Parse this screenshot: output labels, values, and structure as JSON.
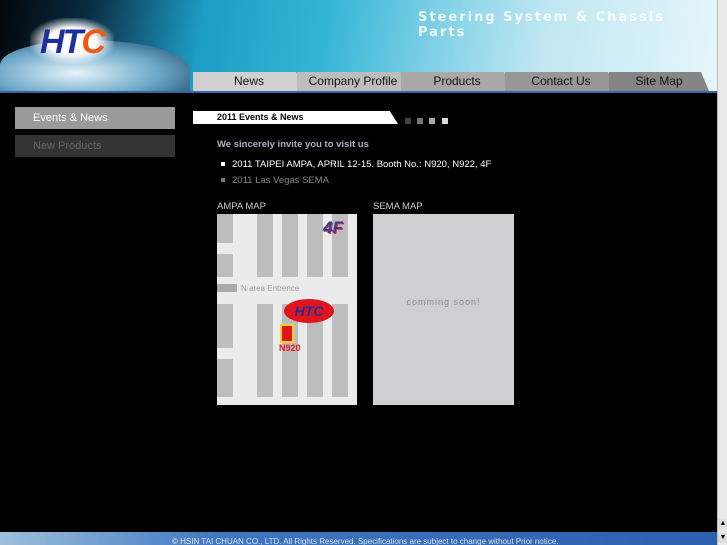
{
  "header": {
    "logo": "HTC",
    "slogan": "Steering System & Chassis Parts"
  },
  "nav": [
    {
      "label": "News"
    },
    {
      "label": "Company Profile"
    },
    {
      "label": "Products"
    },
    {
      "label": "Contact Us"
    },
    {
      "label": "Site Map"
    }
  ],
  "sidebar": {
    "items": [
      {
        "label": "Events & News",
        "active": true
      },
      {
        "label": "New Products",
        "active": false
      }
    ]
  },
  "main": {
    "title": "2011 Events & News",
    "intro": "We sincerely invite you to visit us",
    "events": [
      "2011 TAIPEI AMPA, APRIL 12-15. Booth No.: N920, N922, 4F",
      "2011 Las Vegas SEMA"
    ],
    "ampa_map": {
      "label": "AMPA MAP",
      "floor": "4F",
      "entrance": "N area Entrence",
      "booth": "N920",
      "logo": "HTC"
    },
    "sema_map": {
      "label": "SEMA MAP",
      "status": "comming soon!"
    }
  },
  "footer": {
    "text": "© HSIN TAI CHUAN CO., LTD. All Rights Reserved. Specifications are subject to change without Prior notice."
  },
  "colors": {
    "accent_blue": "#1d2f9c",
    "logo_orange": "#f25b0f",
    "booth_red": "#e0141c"
  }
}
